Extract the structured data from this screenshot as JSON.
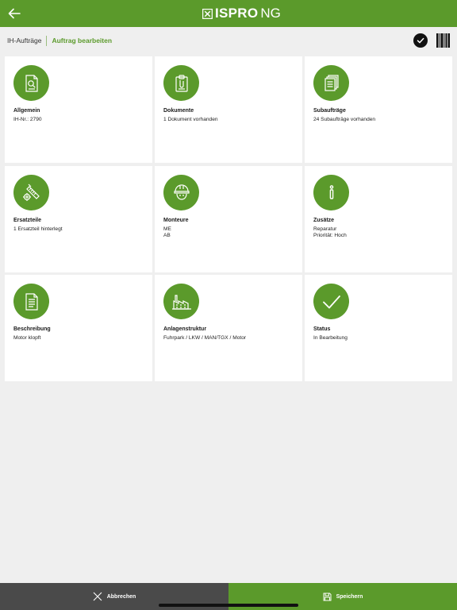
{
  "header": {
    "logo_bold": "ISPRO",
    "logo_suffix": "NG"
  },
  "breadcrumb": {
    "root": "IH-Aufträge",
    "current": "Auftrag bearbeiten"
  },
  "cards": [
    {
      "title": "Allgemein",
      "line1": "IH-Nr.: 2790",
      "line2": "",
      "icon": "document-search-icon"
    },
    {
      "title": "Dokumente",
      "line1": "1 Dokument vorhanden",
      "line2": "",
      "icon": "clipboard-icon"
    },
    {
      "title": "Subaufträge",
      "line1": "24 Subaufträge vorhanden",
      "line2": "",
      "icon": "documents-stack-icon"
    },
    {
      "title": "Ersatzteile",
      "line1": "1 Ersatzteil hinterlegt",
      "line2": "",
      "icon": "spare-parts-icon"
    },
    {
      "title": "Monteure",
      "line1": "ME",
      "line2": "AB",
      "icon": "worker-helmet-icon"
    },
    {
      "title": "Zusätze",
      "line1": "Reparatur",
      "line2": "Priorität: Hoch",
      "icon": "info-icon"
    },
    {
      "title": "Beschreibung",
      "line1": "Motor klopft",
      "line2": "",
      "icon": "text-document-icon"
    },
    {
      "title": "Anlagenstruktur",
      "line1": "Fuhrpark / LKW / MAN/TGX / Motor",
      "line2": "",
      "icon": "factory-icon"
    },
    {
      "title": "Status",
      "line1": "In Bearbeitung",
      "line2": "",
      "icon": "checkmark-icon"
    }
  ],
  "footer": {
    "cancel_label": "Abbrechen",
    "save_label": "Speichern"
  },
  "colors": {
    "accent": "#5b9a2b",
    "cancel_bg": "#4a4a4a",
    "background": "#efefef"
  }
}
